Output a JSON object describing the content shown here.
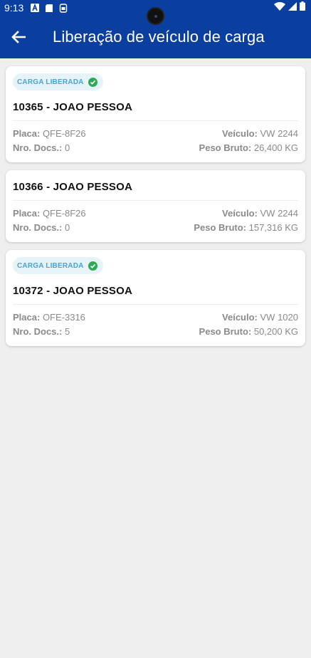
{
  "status_bar": {
    "time": "9:13"
  },
  "app_bar": {
    "title": "Liberação de veículo de carga"
  },
  "labels": {
    "placa": "Placa:",
    "nro_docs": "Nro. Docs.:",
    "veiculo": "Veículo:",
    "peso_bruto": "Peso Bruto:"
  },
  "cards": [
    {
      "badge": "CARGA LIBERADA",
      "title": "10365 - JOAO PESSOA",
      "placa": "QFE-8F26",
      "nro_docs": "0",
      "veiculo": "VW 2244",
      "peso_bruto": "26,400 KG"
    },
    {
      "title": "10366 - JOAO PESSOA",
      "placa": "QFE-8F26",
      "nro_docs": "0",
      "veiculo": "VW 2244",
      "peso_bruto": "157,316 KG"
    },
    {
      "badge": "CARGA LIBERADA",
      "title": "10372 - JOAO PESSOA",
      "placa": "OFE-3316",
      "nro_docs": "5",
      "veiculo": "VW 1020",
      "peso_bruto": "50,200 KG"
    }
  ],
  "colors": {
    "app_bar": "#0a3f9f",
    "badge_text": "#4aa3d4",
    "badge_bg": "#e6f3f9",
    "check": "#2eaa55"
  }
}
